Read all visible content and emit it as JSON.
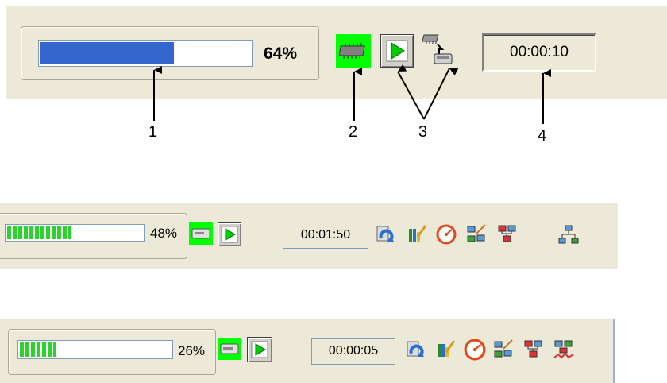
{
  "panel1": {
    "progress_percent": 64,
    "progress_label": "64%",
    "timer": "00:00:10",
    "chip_color": "#00ff00",
    "fill_color": "#3366cc"
  },
  "callouts": [
    "1",
    "2",
    "3",
    "4"
  ],
  "panel2": {
    "progress_percent": 48,
    "progress_label": "48%",
    "timer": "00:01:50"
  },
  "panel3": {
    "progress_percent": 26,
    "progress_label": "26%",
    "timer": "00:00:05"
  },
  "icons": [
    "refresh-icon",
    "edit-icon",
    "gauge-icon",
    "network-edit-icon",
    "network-map-icon",
    "network-monitor-icon",
    "network-topology-icon"
  ],
  "colors": {
    "toolbar_bg": "#ece9d8",
    "progress_green": "#2bd42b",
    "active_green": "#00ff00"
  }
}
